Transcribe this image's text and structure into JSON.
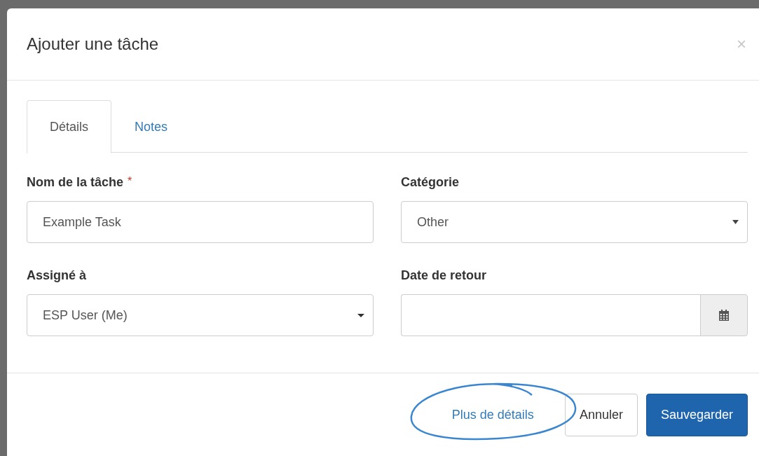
{
  "dialog": {
    "title": "Ajouter une tâche",
    "close": "×"
  },
  "tabs": [
    {
      "label": "Détails",
      "selected": true
    },
    {
      "label": "Notes",
      "selected": false
    }
  ],
  "fields": [
    {
      "label": "Nom de la tâche",
      "required_marker": "*",
      "kind": "text",
      "value": "Example Task"
    },
    {
      "label": "Catégorie",
      "kind": "select",
      "value": "Other"
    },
    {
      "label": "Assigné à",
      "kind": "dropdown",
      "value": "ESP User (Me)"
    },
    {
      "label": "Date de retour",
      "kind": "date"
    }
  ],
  "footer": {
    "link": "Plus de détails",
    "buttons": [
      {
        "label": "Annuler",
        "kind": "default"
      },
      {
        "label": "Sauvegarder",
        "kind": "primary"
      }
    ]
  }
}
